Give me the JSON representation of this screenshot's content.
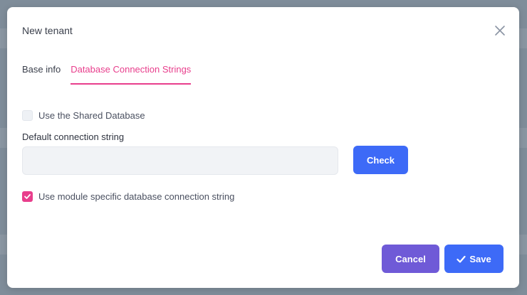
{
  "modal": {
    "title": "New tenant"
  },
  "tabs": [
    {
      "label": "Base info",
      "active": false
    },
    {
      "label": "Database Connection Strings",
      "active": true
    }
  ],
  "shared_db": {
    "label": "Use the Shared Database",
    "checked": false
  },
  "connection": {
    "label": "Default connection string",
    "value": "",
    "placeholder": ""
  },
  "buttons": {
    "check": "Check",
    "cancel": "Cancel",
    "save": "Save"
  },
  "module_specific": {
    "label": "Use module specific database connection string",
    "checked": true
  },
  "colors": {
    "accent_pink": "#e83e8c",
    "primary_blue": "#3d6af7",
    "cancel_purple": "#6f5ad7"
  },
  "icons": {
    "close": "close-icon",
    "save": "check-icon"
  }
}
